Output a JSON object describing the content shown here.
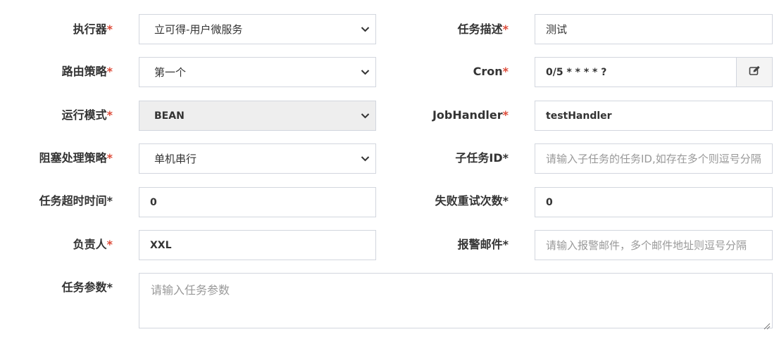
{
  "form": {
    "executor": {
      "label": "执行器",
      "required_mark": "*",
      "value": "立可得-用户微服务"
    },
    "description": {
      "label": "任务描述",
      "required_mark": "*",
      "value": "测试"
    },
    "route_strategy": {
      "label": "路由策略",
      "required_mark": "*",
      "value": "第一个"
    },
    "cron": {
      "label": "Cron",
      "required_mark": "*",
      "value": "0/5 * * * * ?",
      "button_icon": "edit-icon"
    },
    "run_mode": {
      "label": "运行模式",
      "required_mark": "*",
      "value": "BEAN"
    },
    "job_handler": {
      "label": "JobHandler",
      "required_mark": "*",
      "value": "testHandler"
    },
    "block_strategy": {
      "label": "阻塞处理策略",
      "required_mark": "*",
      "value": "单机串行"
    },
    "child_job_id": {
      "label": "子任务ID",
      "required_mark": "*",
      "placeholder": "请输入子任务的任务ID,如存在多个则逗号分隔"
    },
    "timeout": {
      "label": "任务超时时间",
      "required_mark": "*",
      "value": "0"
    },
    "retry_count": {
      "label": "失败重试次数",
      "required_mark": "*",
      "value": "0"
    },
    "owner": {
      "label": "负责人",
      "required_mark": "*",
      "value": "XXL"
    },
    "alarm_email": {
      "label": "报警邮件",
      "required_mark": "*",
      "placeholder": "请输入报警邮件，多个邮件地址则逗号分隔"
    },
    "params": {
      "label": "任务参数",
      "required_mark": "*",
      "placeholder": "请输入任务参数"
    }
  },
  "colors": {
    "required": "#dd4b39",
    "border": "#d2d6de",
    "disabled_bg": "#eeeeee"
  }
}
